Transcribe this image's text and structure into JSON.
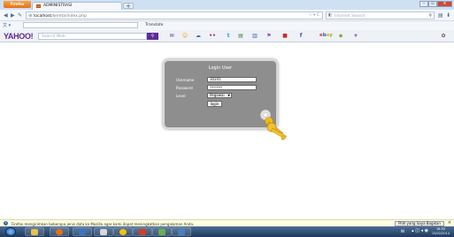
{
  "browser": {
    "firefox_label": "Firefox",
    "tab_title": "ADMINISTRASI",
    "new_tab_symbol": "+",
    "url_prefix": "localhost",
    "url_rest": "/kereta/index.php",
    "url_right": "☆ ▾ C",
    "search_placeholder": "Internet Search",
    "translate_label": "Translate",
    "yahoo_logo": "YAHOO!",
    "yahoo_search_placeholder": "Search Web",
    "ebay_label": "ebay"
  },
  "login": {
    "title": "Login User",
    "username_label": "Username",
    "username_value": "30241",
    "password_label": "Password",
    "password_value": "••••••",
    "level_label": "Level",
    "level_value": "Pegawai",
    "login_button": "login"
  },
  "notification": {
    "text": "Firefox mengirimkan beberapa jenis data ke Mozilla agar kami dapat meningkatkan pengalaman Anda.",
    "button_label": "Pilih yang Saya Bagikan",
    "close_symbol": "×"
  },
  "taskbar": {
    "lang": "IN",
    "time": "16:55",
    "date": "15/02/2014"
  },
  "colors": {
    "yahoo_purple": "#5f2a9a",
    "login_box_bg": "#8e8e8e",
    "key_gold": "#f0b820"
  }
}
